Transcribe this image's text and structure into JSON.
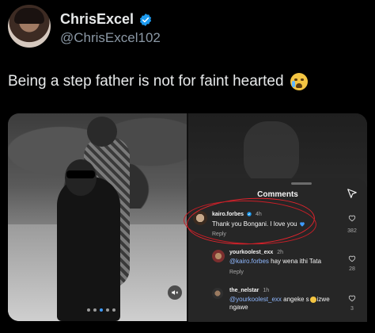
{
  "header": {
    "display_name": "ChrisExcel",
    "handle": "@ChrisExcel102",
    "verified_color": "#1d9bf0"
  },
  "tweet": {
    "text": "Being a step father is not for faint hearted",
    "emoji": "loudly-crying-face"
  },
  "media": {
    "carousel": {
      "page_count": 5,
      "active_index": 2
    },
    "video_badge_icon": "volume-off-icon"
  },
  "comments_sheet": {
    "title": "Comments",
    "send_icon": "paper-plane-icon",
    "comments": [
      {
        "user": "kairo.forbes",
        "time": "4h",
        "text": "Thank you Bongani. I love you",
        "reply": "Reply",
        "likes": "382"
      },
      {
        "user": "yourkoolest_exx",
        "time": "2h",
        "mention": "@kairo.forbes",
        "text": " hay wena ithi Tata",
        "reply": "Reply",
        "likes": "28"
      },
      {
        "user": "the_nelstar",
        "time": "1h",
        "mention": "@yourkoolest_exx",
        "text": " angeke s",
        "text_after_emoji": "izwe",
        "text_line2": "ngawe",
        "likes": "3"
      }
    ]
  },
  "colors": {
    "background": "#000000",
    "mention": "#8fb8ff",
    "highlight_ring": "#e0242d",
    "carousel_active": "#3e9bff"
  }
}
